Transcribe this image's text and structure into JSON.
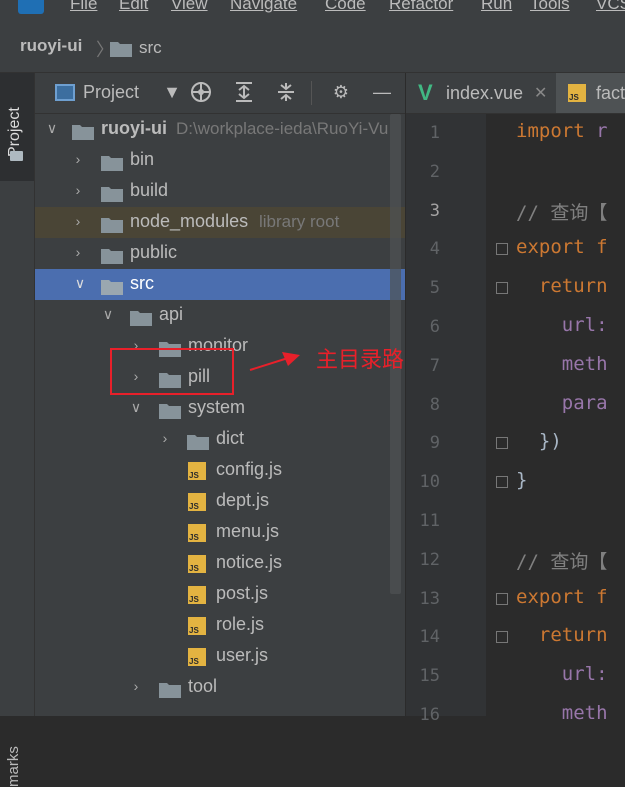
{
  "menubar": {
    "items": [
      "File",
      "Edit",
      "View",
      "Navigate",
      "Code",
      "Refactor",
      "Run",
      "Tools",
      "VCS"
    ]
  },
  "navbar": {
    "project": "ruoyi-ui",
    "folder": "src"
  },
  "left_strip": {
    "project_tab": "Project",
    "bookmarks_tab": "marks"
  },
  "project_panel": {
    "title": "Project",
    "tree": [
      {
        "label": "ruoyi-ui",
        "extra": "D:\\workplace-ieda\\RuoYi-Vu",
        "kind": "folder",
        "state": "expanded",
        "bold": true
      },
      {
        "label": "bin",
        "kind": "folder",
        "state": "collapsed"
      },
      {
        "label": "build",
        "kind": "folder",
        "state": "collapsed"
      },
      {
        "label": "node_modules",
        "extra": "library root",
        "kind": "folder",
        "state": "collapsed",
        "excluded": true
      },
      {
        "label": "public",
        "kind": "folder",
        "state": "collapsed"
      },
      {
        "label": "src",
        "kind": "folder",
        "state": "expanded",
        "selected": true
      },
      {
        "label": "api",
        "kind": "folder",
        "state": "expanded"
      },
      {
        "label": "monitor",
        "kind": "folder",
        "state": "collapsed"
      },
      {
        "label": "pill",
        "kind": "folder",
        "state": "collapsed"
      },
      {
        "label": "system",
        "kind": "folder",
        "state": "expanded"
      },
      {
        "label": "dict",
        "kind": "folder",
        "state": "collapsed"
      },
      {
        "label": "config.js",
        "kind": "js"
      },
      {
        "label": "dept.js",
        "kind": "js"
      },
      {
        "label": "menu.js",
        "kind": "js"
      },
      {
        "label": "notice.js",
        "kind": "js"
      },
      {
        "label": "post.js",
        "kind": "js"
      },
      {
        "label": "role.js",
        "kind": "js"
      },
      {
        "label": "user.js",
        "kind": "js"
      },
      {
        "label": "tool",
        "kind": "folder",
        "state": "collapsed"
      }
    ]
  },
  "annotation": {
    "text": "主目录路由地址",
    "color": "#e8202a"
  },
  "editor": {
    "tabs": [
      {
        "label": "index.vue",
        "active": false
      },
      {
        "label": "fact",
        "active": true
      }
    ],
    "line_numbers": [
      "1",
      "2",
      "3",
      "4",
      "5",
      "6",
      "7",
      "8",
      "9",
      "10",
      "11",
      "12",
      "13",
      "14",
      "15",
      "16"
    ],
    "current_line": "3",
    "lines": [
      {
        "n": "1",
        "parts": [
          {
            "t": "import ",
            "c": "kw"
          },
          {
            "t": "r",
            "c": "pr"
          }
        ]
      },
      {
        "n": "2",
        "parts": []
      },
      {
        "n": "3",
        "parts": [
          {
            "t": "// 查询【",
            "c": "cm"
          }
        ]
      },
      {
        "n": "4",
        "parts": [
          {
            "t": "export f",
            "c": "kw"
          }
        ]
      },
      {
        "n": "5",
        "parts": [
          {
            "t": "  return",
            "c": "kw"
          }
        ]
      },
      {
        "n": "6",
        "parts": [
          {
            "t": "    url:",
            "c": "pr"
          }
        ]
      },
      {
        "n": "7",
        "parts": [
          {
            "t": "    meth",
            "c": "pr"
          }
        ]
      },
      {
        "n": "8",
        "parts": [
          {
            "t": "    para",
            "c": "pr"
          }
        ]
      },
      {
        "n": "9",
        "parts": [
          {
            "t": "  })",
            "c": "pl"
          }
        ]
      },
      {
        "n": "10",
        "parts": [
          {
            "t": "}",
            "c": "pl"
          }
        ]
      },
      {
        "n": "11",
        "parts": []
      },
      {
        "n": "12",
        "parts": [
          {
            "t": "// 查询【",
            "c": "cm"
          }
        ]
      },
      {
        "n": "13",
        "parts": [
          {
            "t": "export f",
            "c": "kw"
          }
        ]
      },
      {
        "n": "14",
        "parts": [
          {
            "t": "  return",
            "c": "kw"
          }
        ]
      },
      {
        "n": "15",
        "parts": [
          {
            "t": "    url:",
            "c": "pr"
          }
        ]
      },
      {
        "n": "16",
        "parts": [
          {
            "t": "    meth",
            "c": "pr"
          }
        ]
      }
    ]
  },
  "colors": {
    "selection": "#4b6eaf",
    "excluded": "#4a4536",
    "keyword": "#cc7832",
    "property": "#9876aa",
    "comment": "#808080",
    "vue": "#41b883",
    "js_icon": "#e3b341"
  }
}
